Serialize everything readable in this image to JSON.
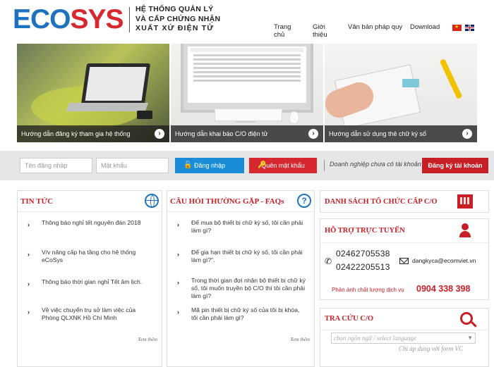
{
  "header": {
    "logo_left": "ECO",
    "logo_right": "SYS",
    "tagline": [
      "HỆ THỐNG QUẢN LÝ",
      "VÀ CẤP CHỨNG NHẬN",
      "XUẤT XỨ ĐIỆN TỬ"
    ],
    "nav": [
      "Trang chủ",
      "Giới thiệu",
      "Văn bản pháp quy",
      "Download"
    ],
    "languages": [
      "vn-flag-icon",
      "en-flag-icon"
    ]
  },
  "banners": [
    {
      "caption": "Hướng dẫn đăng ký tham gia hệ thống",
      "icon": "arrow-right-circle-icon"
    },
    {
      "caption": "Hướng dẫn khai báo C/O điện tử",
      "icon": "arrow-right-circle-icon"
    },
    {
      "caption": "Hướng dẫn sử dụng thẻ chữ ký số",
      "icon": "arrow-right-circle-icon"
    }
  ],
  "login": {
    "username_placeholder": "Tên đăng nhập",
    "password_placeholder": "Mật khẩu",
    "login_label": "Đăng nhập",
    "forgot_label": "Quên mật khẩu",
    "no_account_text": "Doanh nghiệp chưa có tài khoản?",
    "register_label": "Đăng ký tài khoản"
  },
  "news": {
    "title": "TIN TỨC",
    "items": [
      "Thông báo nghỉ tết nguyên đán 2018",
      "V/v nâng cấp hạ tầng cho hệ thống eCoSys",
      "Thông báo thời gian nghỉ Tết âm lịch.",
      "Về việc chuyển trụ sở làm việc của Phòng QLXNK Hồ Chí Minh"
    ],
    "see_more": "Xem thêm"
  },
  "faq": {
    "title": "CÂU HỎI THƯỜNG GẶP - FAQs",
    "items": [
      "Để mua bộ thiết bị chữ ký số, tôi cần phải làm gì?",
      "Để gia hạn thiết bị chữ ký số, tôi cần phải làm gì?\".",
      "Trong thời gian đợi nhận bộ thiết bị chữ ký số, tôi muốn truyền bộ C/O thì tôi cần phải làm gì?",
      "Mã pin thiết bị chữ ký số của tôi bị khóa, tôi cần phải làm gì?"
    ],
    "see_more": "Xem thêm"
  },
  "sidebar": {
    "list_title": "DANH SÁCH TỔ CHỨC CẤP C/O",
    "support_title": "HỖ TRỢ TRỰC TUYẾN",
    "phones": [
      "02462705538",
      "02422205513"
    ],
    "email": "dangkyca@ecomviet.vn",
    "feedback_label": "Phản ánh chất lượng dịch vụ",
    "hotline": "0904 338 398",
    "lookup_title": "TRA CỨU C/O",
    "language_select": "chọn ngôn ngữ / select language",
    "lookup_note": "Chỉ áp dụng với form VC"
  },
  "colors": {
    "brand_blue": "#1e73be",
    "brand_red": "#d7282f",
    "login_blue": "#1b8dd8"
  }
}
